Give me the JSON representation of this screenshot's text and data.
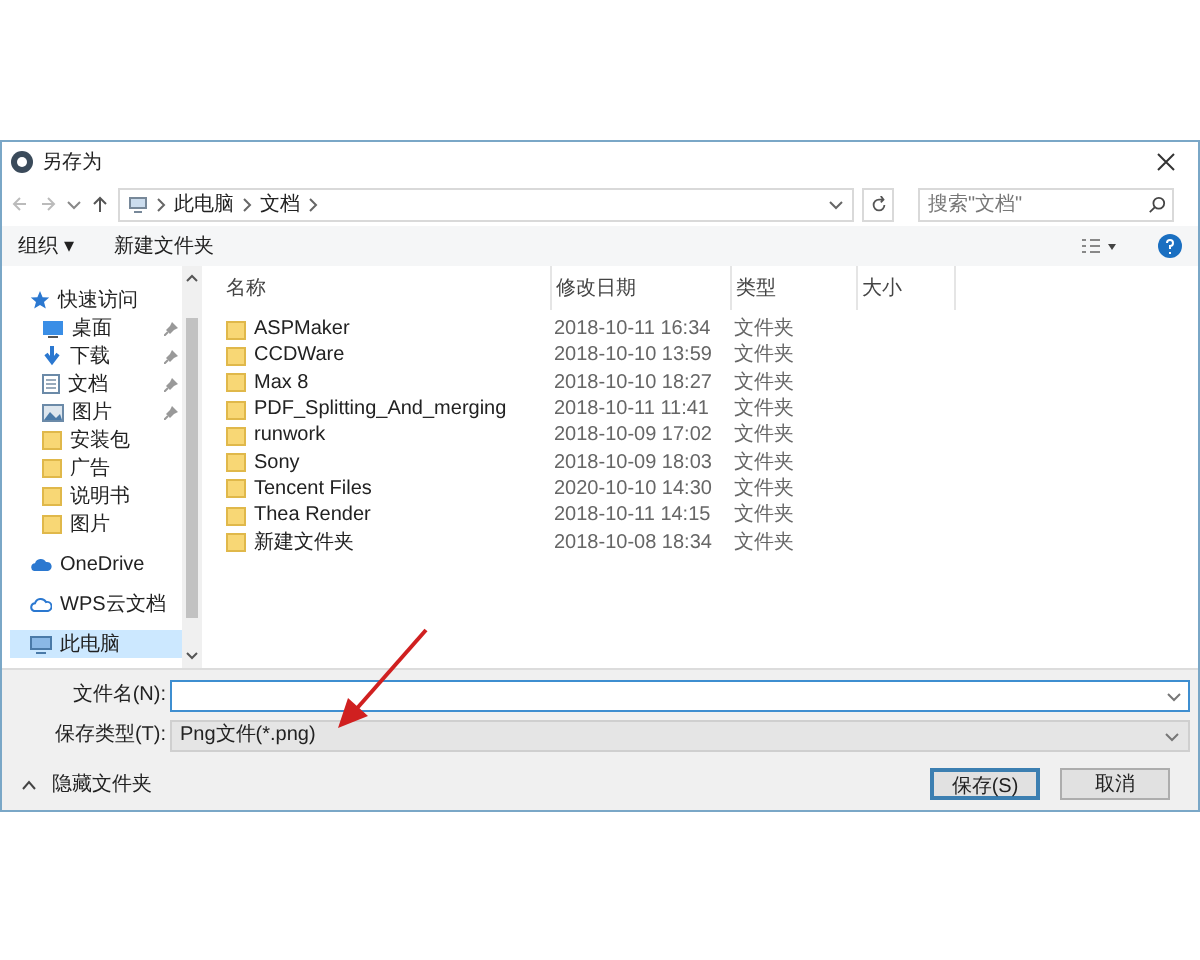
{
  "window": {
    "title": "另存为"
  },
  "address": {
    "path": [
      {
        "label": "此电脑"
      },
      {
        "label": "文档"
      }
    ],
    "search_placeholder": "搜索\"文档\""
  },
  "toolbar": {
    "organize": "组织 ▾",
    "new_folder": "新建文件夹"
  },
  "sidebar": {
    "items": [
      {
        "kind": "quick",
        "label": "快速访问",
        "pinned": false
      },
      {
        "kind": "desktop",
        "label": "桌面",
        "pinned": true
      },
      {
        "kind": "download",
        "label": "下载",
        "pinned": true
      },
      {
        "kind": "document",
        "label": "文档",
        "pinned": true
      },
      {
        "kind": "picture",
        "label": "图片",
        "pinned": true
      },
      {
        "kind": "folder",
        "label": "安装包",
        "pinned": false
      },
      {
        "kind": "folder",
        "label": "广告",
        "pinned": false
      },
      {
        "kind": "folder",
        "label": "说明书",
        "pinned": false
      },
      {
        "kind": "folder",
        "label": "图片",
        "pinned": false
      },
      {
        "kind": "cloud",
        "label": "OneDrive",
        "pinned": false
      },
      {
        "kind": "wps",
        "label": "WPS云文档",
        "pinned": false
      },
      {
        "kind": "pc",
        "label": "此电脑",
        "pinned": false,
        "selected": true
      }
    ]
  },
  "table": {
    "columns": [
      "名称",
      "修改日期",
      "类型",
      "大小"
    ],
    "rows": [
      {
        "name": "ASPMaker",
        "date": "2018-10-11 16:34",
        "type": "文件夹"
      },
      {
        "name": "CCDWare",
        "date": "2018-10-10 13:59",
        "type": "文件夹"
      },
      {
        "name": "Max 8",
        "date": "2018-10-10 18:27",
        "type": "文件夹"
      },
      {
        "name": "PDF_Splitting_And_merging",
        "date": "2018-10-11 11:41",
        "type": "文件夹"
      },
      {
        "name": "runwork",
        "date": "2018-10-09 17:02",
        "type": "文件夹"
      },
      {
        "name": "Sony",
        "date": "2018-10-09 18:03",
        "type": "文件夹"
      },
      {
        "name": "Tencent Files",
        "date": "2020-10-10 14:30",
        "type": "文件夹"
      },
      {
        "name": "Thea Render",
        "date": "2018-10-11 14:15",
        "type": "文件夹"
      },
      {
        "name": "新建文件夹",
        "date": "2018-10-08 18:34",
        "type": "文件夹"
      }
    ]
  },
  "form": {
    "filename_label": "文件名(N):",
    "filetype_label": "保存类型(T):",
    "filetype_value": "Png文件(*.png)"
  },
  "footer": {
    "hide_folders": "隐藏文件夹",
    "save": "保存(S)",
    "cancel": "取消"
  }
}
